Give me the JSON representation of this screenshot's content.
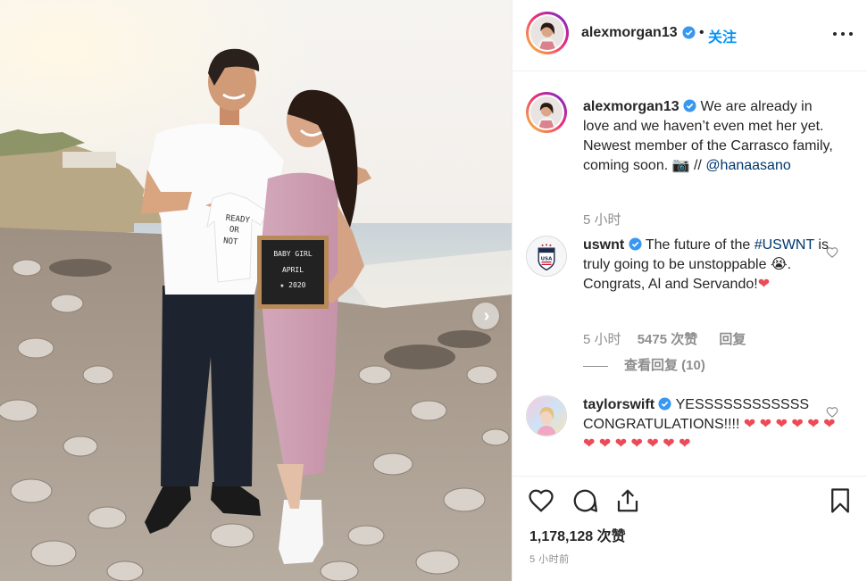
{
  "post": {
    "username": "alexmorgan13",
    "follow_label": "关注",
    "dot": "•",
    "caption_parts": [
      "We are already in love and we haven’t even met her yet. Newest member of the Carrasco family, coming soon. ",
      "📷",
      " // "
    ],
    "caption_mention": "@hanaasano",
    "caption_time": "5 小时",
    "likes": "1,178,128 次赞",
    "timestamp": "5 小时前",
    "photo": {
      "onesie_text": [
        "READY",
        "OR",
        "NOT"
      ],
      "letterboard_text": [
        "BABY GIRL",
        "APRIL",
        "★ 2020"
      ]
    }
  },
  "comments": [
    {
      "username": "uswnt",
      "text_before": "The future of the ",
      "hashtag": "#USWNT",
      "text_after": " is truly going to be unstoppable ",
      "emoji": "😭",
      "text_end": ". Congrats, Al and Servando!",
      "heart": "❤",
      "time": "5 小时",
      "likes": "5475 次赞",
      "reply_label": "回复",
      "view_replies": "查看回复 (10)"
    },
    {
      "username": "taylorswift",
      "text": "YESSSSSSSSSSSS CONGRATULATIONS!!!! ",
      "hearts": "❤ ❤ ❤ ❤ ❤ ❤ ❤ ❤ ❤ ❤ ❤ ❤ ❤"
    }
  ],
  "icons": {
    "verified_color": "#3897f0",
    "follow_color": "#0095f6",
    "link_color": "#00376b",
    "heart_color": "#ed4956",
    "next": "chevron-right-icon",
    "more": "more-options-icon",
    "like": "heart-icon",
    "comment": "comment-icon",
    "share": "share-icon",
    "save": "bookmark-icon"
  }
}
